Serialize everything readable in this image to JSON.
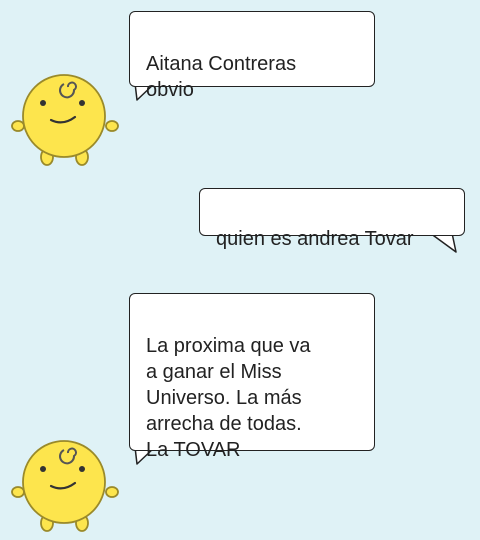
{
  "colors": {
    "background": "#dff2f6",
    "bubble_fill": "#ffffff",
    "bubble_border": "#222222",
    "text": "#222222",
    "avatar_body": "#fde54d",
    "avatar_outline": "#9a8a2a"
  },
  "messages": [
    {
      "sender": "bot",
      "avatar_icon": "simsimi-chick-icon",
      "text": "Aitana Contreras\nobvio"
    },
    {
      "sender": "user",
      "text": "quien es andrea Tovar"
    },
    {
      "sender": "bot",
      "avatar_icon": "simsimi-chick-icon",
      "text": "La proxima que va\na ganar el Miss\nUniverso. La más\narrecha de todas.\nLa TOVAR"
    }
  ]
}
